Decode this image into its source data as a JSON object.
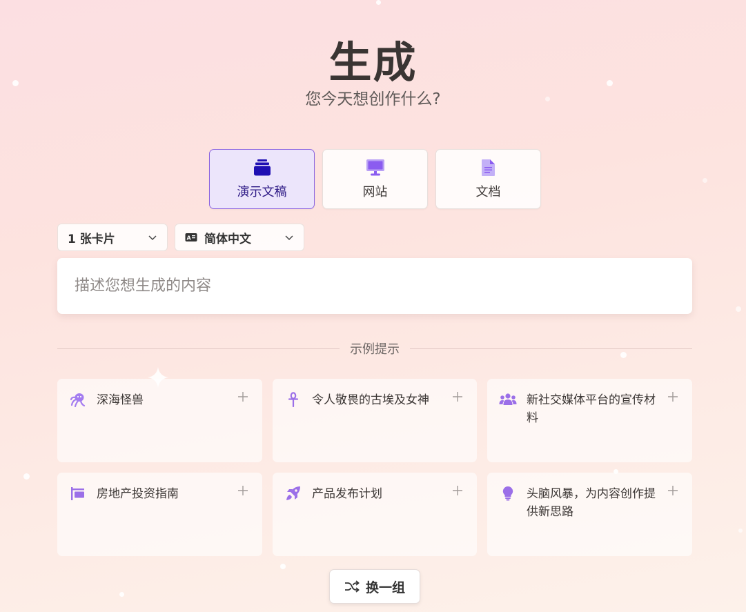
{
  "header": {
    "title": "生成",
    "subtitle": "您今天想创作什么?"
  },
  "modes": [
    {
      "label": "演示文稿",
      "icon": "presentation-stack-icon",
      "active": true
    },
    {
      "label": "网站",
      "icon": "monitor-icon",
      "active": false
    },
    {
      "label": "文档",
      "icon": "document-icon",
      "active": false
    }
  ],
  "options": {
    "cards_count": "1 张卡片",
    "language": "简体中文",
    "language_icon": "language-icon"
  },
  "prompt": {
    "placeholder": "描述您想生成的内容",
    "value": ""
  },
  "examples": {
    "heading": "示例提示",
    "items": [
      {
        "text": "深海怪兽",
        "icon": "octopus-icon"
      },
      {
        "text": "令人敬畏的古埃及女神",
        "icon": "ankh-icon"
      },
      {
        "text": "新社交媒体平台的宣传材料",
        "icon": "users-icon"
      },
      {
        "text": "房地产投资指南",
        "icon": "sign-icon"
      },
      {
        "text": "产品发布计划",
        "icon": "rocket-icon"
      },
      {
        "text": "头脑风暴，为内容创作提供新思路",
        "icon": "lightbulb-icon"
      }
    ]
  },
  "shuffle": {
    "label": "换一组",
    "icon": "shuffle-icon"
  },
  "colors": {
    "accent": "#8a63e0",
    "accent_dark": "#2e1a86",
    "icon_purple": "#9b6fe8",
    "active_bg": "#ece5fb"
  }
}
